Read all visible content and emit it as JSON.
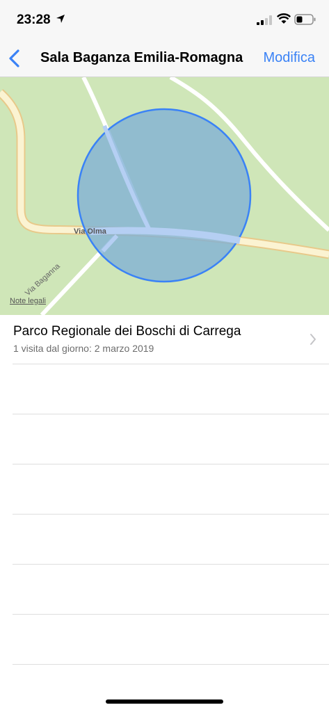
{
  "status_bar": {
    "time": "23:28"
  },
  "nav": {
    "back_icon": "chevron-left-icon",
    "title": "Sala Baganza Emilia-Romagna",
    "edit_label": "Modifica"
  },
  "map": {
    "street_labels": [
      "Via Olma",
      "Via Baganna"
    ],
    "legal_label": "Note legali",
    "region_fill": "#7fb0d6",
    "region_stroke": "#3a82f6"
  },
  "visit": {
    "title": "Parco Regionale dei Boschi di Carrega",
    "subtitle": "1 visita dal giorno: 2 marzo 2019"
  },
  "colors": {
    "accent": "#3a82f6",
    "map_background": "#cfe6b8"
  }
}
